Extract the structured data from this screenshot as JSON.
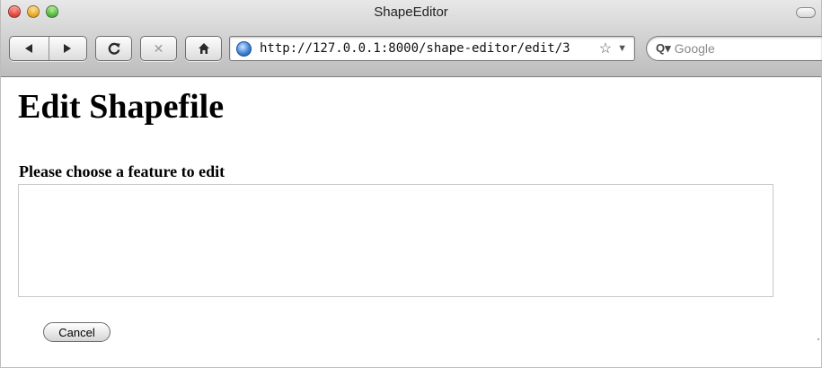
{
  "window": {
    "title": "ShapeEditor"
  },
  "toolbar": {
    "back_icon": "back-arrow-icon",
    "forward_icon": "forward-arrow-icon",
    "reload_glyph": "C",
    "stop_glyph": "✕",
    "home_icon": "home-icon"
  },
  "address_bar": {
    "url": "http://127.0.0.1:8000/shape-editor/edit/3"
  },
  "search": {
    "placeholder": "Google"
  },
  "page": {
    "heading": "Edit Shapefile",
    "feature_label": "Please choose a feature to edit",
    "cancel_label": "Cancel"
  },
  "colors": {
    "close": "#e0443a",
    "minimize": "#e8a825",
    "zoom": "#4fb83a"
  }
}
